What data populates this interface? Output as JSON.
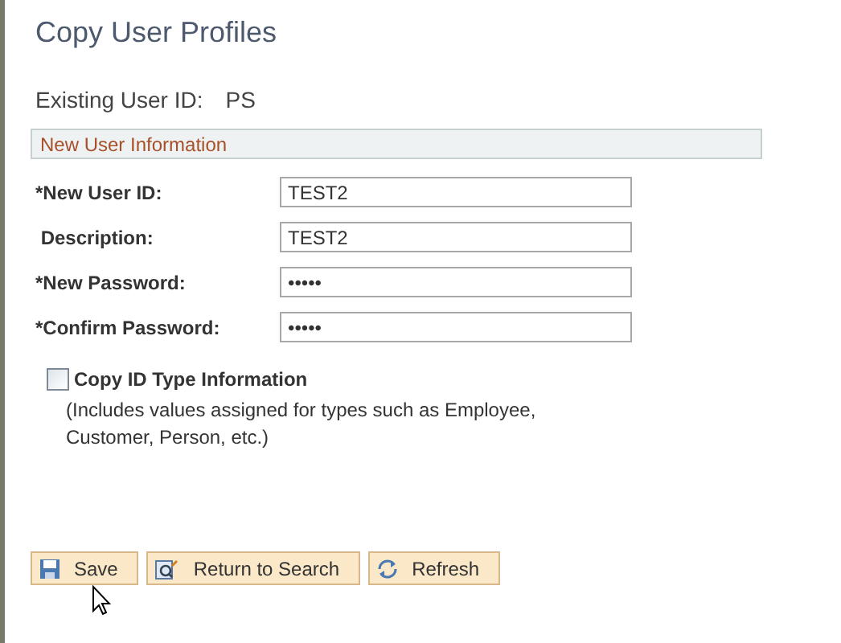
{
  "title": "Copy User Profiles",
  "existing": {
    "label": "Existing User ID:",
    "value": "PS"
  },
  "section": {
    "title": "New User Information"
  },
  "fields": [
    {
      "label": "*New User ID:",
      "value": "TEST2"
    },
    {
      "label": " Description:",
      "value": "TEST2"
    },
    {
      "label": "*New Password:",
      "value": "•••••"
    },
    {
      "label": "*Confirm Password:",
      "value": "•••••"
    }
  ],
  "checkbox": {
    "label": "Copy ID Type Information",
    "checked": false,
    "note": "(Includes values assigned for types such as Employee, Customer, Person, etc.)"
  },
  "buttons": [
    {
      "kind": "save",
      "label": "Save"
    },
    {
      "kind": "search",
      "label": "Return to Search"
    },
    {
      "kind": "refresh",
      "label": "Refresh"
    }
  ]
}
